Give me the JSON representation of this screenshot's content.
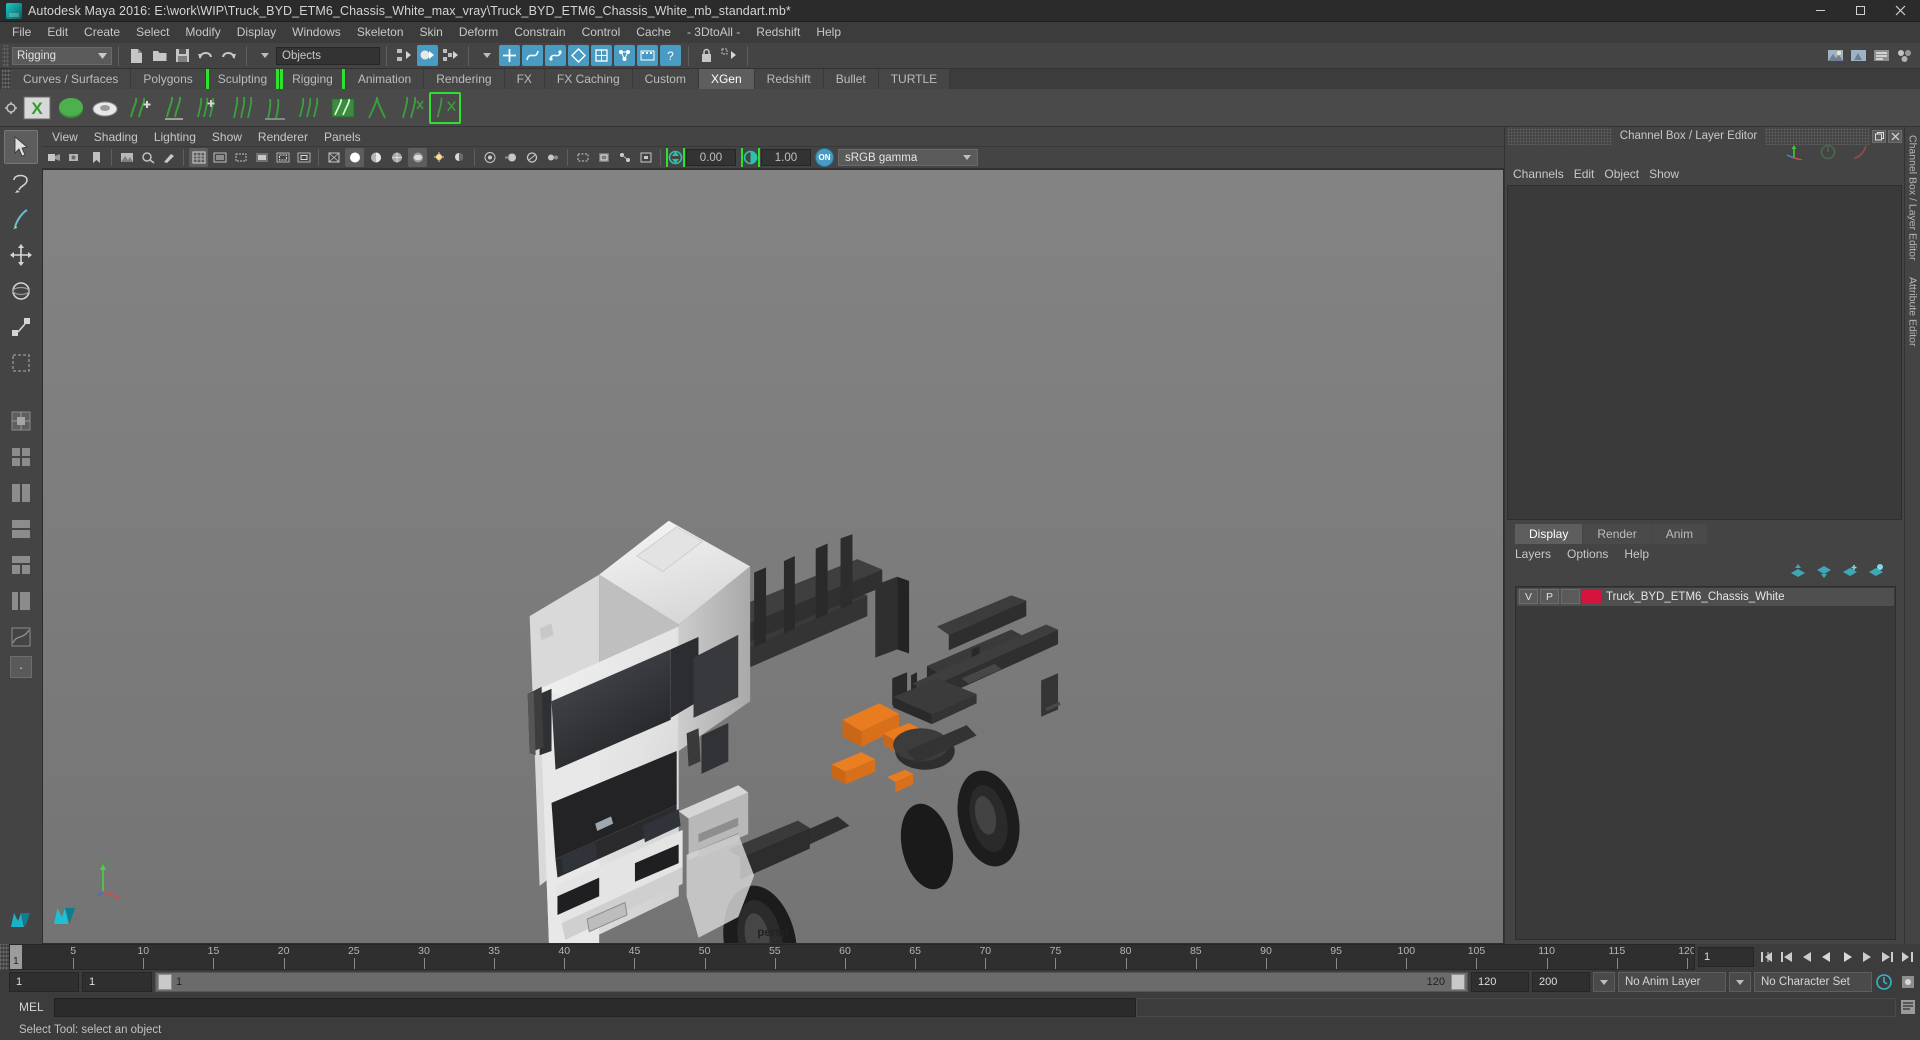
{
  "window": {
    "title": "Autodesk Maya 2016: E:\\work\\WIP\\Truck_BYD_ETM6_Chassis_White_max_vray\\Truck_BYD_ETM6_Chassis_White_mb_standart.mb*",
    "minimize_label": "Minimize",
    "maximize_label": "Maximize",
    "close_label": "Close"
  },
  "menubar": {
    "items": [
      {
        "label": "File"
      },
      {
        "label": "Edit"
      },
      {
        "label": "Create"
      },
      {
        "label": "Select"
      },
      {
        "label": "Modify"
      },
      {
        "label": "Display"
      },
      {
        "label": "Windows"
      },
      {
        "label": "Skeleton"
      },
      {
        "label": "Skin"
      },
      {
        "label": "Deform"
      },
      {
        "label": "Constrain"
      },
      {
        "label": "Control"
      },
      {
        "label": "Cache"
      },
      {
        "label": "- 3DtoAll -"
      },
      {
        "label": "Redshift"
      },
      {
        "label": "Help"
      }
    ]
  },
  "toolbar": {
    "menuset_value": "Rigging",
    "selection_mask_value": "Objects"
  },
  "shelf": {
    "tabs": [
      {
        "label": "Curves / Surfaces",
        "active": false
      },
      {
        "label": "Polygons",
        "active": false
      },
      {
        "label": "Sculpting",
        "active": false
      },
      {
        "label": "Rigging",
        "active": false
      },
      {
        "label": "Animation",
        "active": false
      },
      {
        "label": "Rendering",
        "active": false
      },
      {
        "label": "FX",
        "active": false
      },
      {
        "label": "FX Caching",
        "active": false
      },
      {
        "label": "Custom",
        "active": false
      },
      {
        "label": "XGen",
        "active": true
      },
      {
        "label": "Redshift",
        "active": false
      },
      {
        "label": "Bullet",
        "active": false
      },
      {
        "label": "TURTLE",
        "active": false
      }
    ]
  },
  "viewport": {
    "menus": [
      {
        "label": "View"
      },
      {
        "label": "Shading"
      },
      {
        "label": "Lighting"
      },
      {
        "label": "Show"
      },
      {
        "label": "Renderer"
      },
      {
        "label": "Panels"
      }
    ],
    "exposure_value": "0.00",
    "gamma_value": "1.00",
    "color_management_toggle": "ON",
    "color_space": "sRGB gamma",
    "camera_label": "persp"
  },
  "channel_box": {
    "panel_title": "Channel Box / Layer Editor",
    "menus": [
      {
        "label": "Channels"
      },
      {
        "label": "Edit"
      },
      {
        "label": "Object"
      },
      {
        "label": "Show"
      }
    ]
  },
  "layer_editor": {
    "tabs": [
      {
        "label": "Display",
        "active": true
      },
      {
        "label": "Render",
        "active": false
      },
      {
        "label": "Anim",
        "active": false
      }
    ],
    "menus": [
      {
        "label": "Layers"
      },
      {
        "label": "Options"
      },
      {
        "label": "Help"
      }
    ],
    "layers": [
      {
        "visibility": "V",
        "playback": "P",
        "type": "",
        "color": "#d4143c",
        "name": "Truck_BYD_ETM6_Chassis_White"
      }
    ]
  },
  "side_tabs": [
    {
      "label": "Channel Box / Layer Editor"
    },
    {
      "label": "Attribute Editor"
    }
  ],
  "timeline": {
    "start": 1,
    "end": 120,
    "current_frame": "1",
    "tick_labels": [
      5,
      10,
      15,
      20,
      25,
      30,
      35,
      40,
      45,
      50,
      55,
      60,
      65,
      70,
      75,
      80,
      85,
      90,
      95,
      100,
      105,
      110,
      115,
      120
    ],
    "current_frame_field": "1"
  },
  "range_slider": {
    "anim_start": "1",
    "range_start": "1",
    "bar_start_label": "1",
    "bar_end_label": "120",
    "range_end": "120",
    "anim_end": "200",
    "anim_layer": "No Anim Layer",
    "character_set": "No Character Set"
  },
  "command_line": {
    "language_label": "MEL",
    "input_value": "",
    "output_value": ""
  },
  "status_bar": {
    "message": "Select Tool: select an object"
  }
}
